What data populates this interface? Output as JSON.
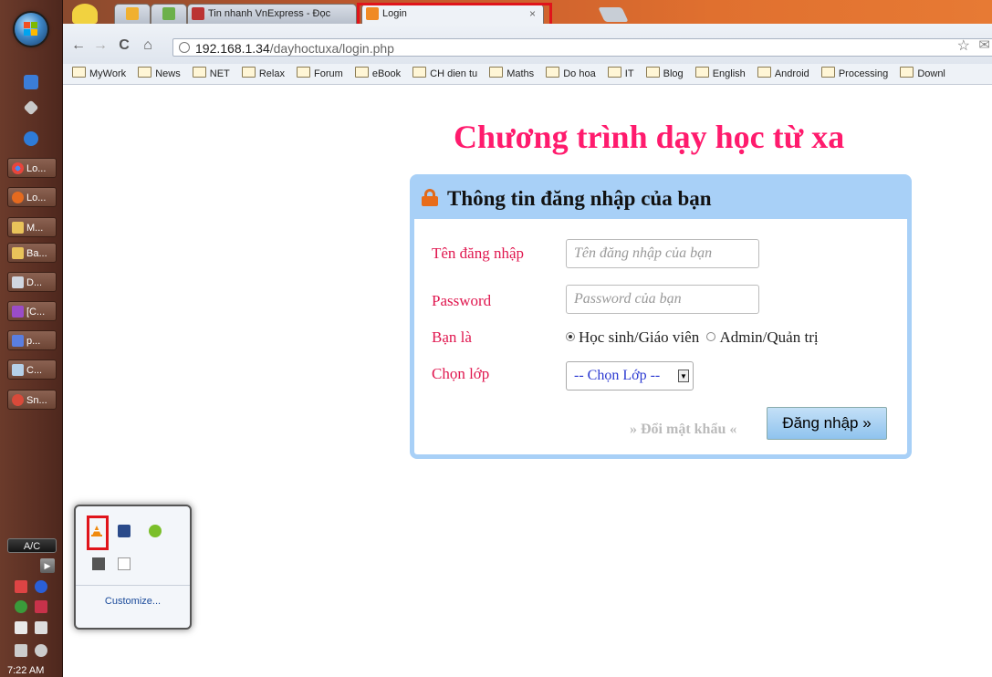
{
  "taskbar": {
    "items": [
      "Lo...",
      "Lo...",
      "M...",
      "Ba...",
      "D...",
      "[C...",
      "p...",
      "C...",
      "Sn..."
    ],
    "ac_label": "A/C",
    "clock": "7:22 AM"
  },
  "browser": {
    "tabs": [
      {
        "label": "Tin nhanh VnExpress - Đọc"
      },
      {
        "label": "Login"
      }
    ],
    "url_host": "192.168.1.34",
    "url_path": "/dayhoctuxa/login.php",
    "bookmarks": [
      "MyWork",
      "News",
      "NET",
      "Relax",
      "Forum",
      "eBook",
      "CH dien tu",
      "Maths",
      "Do hoa",
      "IT",
      "Blog",
      "English",
      "Android",
      "Processing",
      "Downl"
    ]
  },
  "page": {
    "title": "Chương trình dạy học từ xa",
    "panel_title": "Thông tin đăng nhập của bạn",
    "username_label": "Tên đăng nhập",
    "username_placeholder": "Tên đăng nhập của bạn",
    "password_label": "Password",
    "password_placeholder": "Password của bạn",
    "role_label": "Bạn là",
    "role_options": [
      "Học sinh/Giáo viên",
      "Admin/Quản trị"
    ],
    "role_selected": "Học sinh/Giáo viên",
    "class_label": "Chọn lớp",
    "class_select": "-- Chọn Lớp --",
    "change_password": "» Đổi mật khẩu «",
    "login_button": "Đăng nhập »"
  },
  "tray_popup": {
    "customize": "Customize..."
  }
}
